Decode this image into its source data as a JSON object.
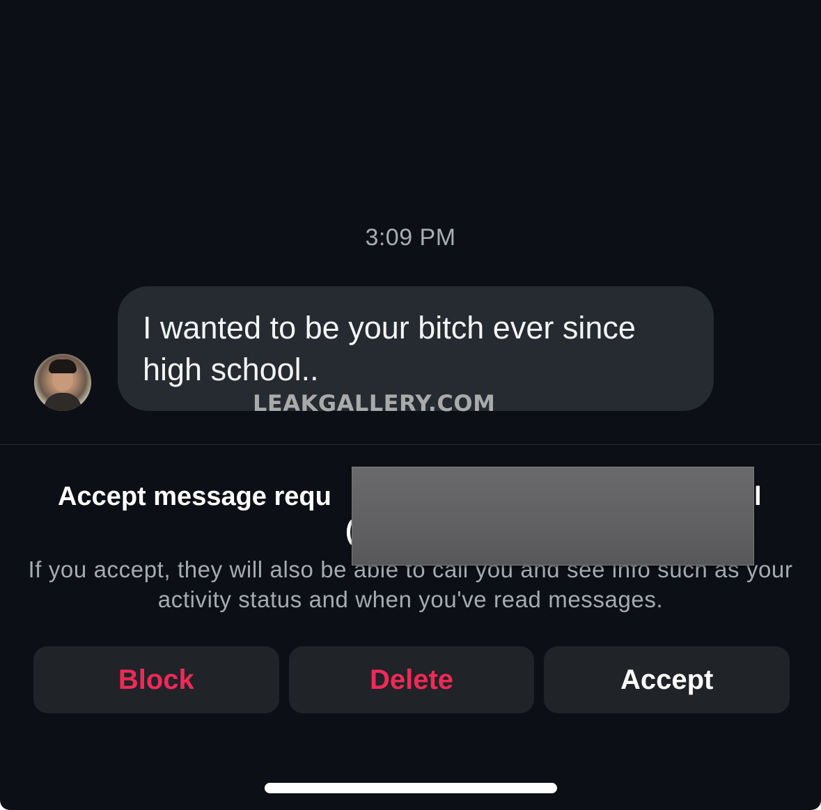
{
  "conversation": {
    "timestamp": "3:09 PM",
    "message": {
      "text": "I wanted to be your bitch ever since high school..",
      "sender_avatar": "avatar"
    }
  },
  "watermark": "LEAKGALLERY.COM",
  "request_prompt": {
    "title_visible_start": "Accept message requ",
    "title_visible_end": "l",
    "title_line2_fragment": "(",
    "description": "If you accept, they will also be able to call you and see info such as your activity status and when you've read messages."
  },
  "actions": {
    "block_label": "Block",
    "delete_label": "Delete",
    "accept_label": "Accept"
  },
  "colors": {
    "background": "#0c1016",
    "bubble": "#262a31",
    "danger": "#f02a58",
    "button_bg": "#202328"
  }
}
